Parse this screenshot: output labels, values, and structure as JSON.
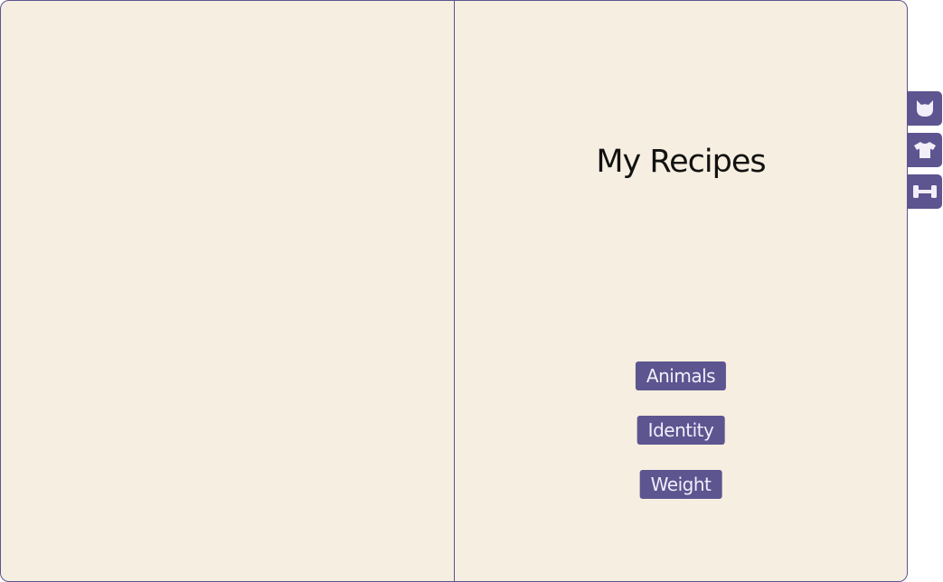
{
  "book": {
    "title": "My Recipes",
    "categories": [
      {
        "label": "Animals"
      },
      {
        "label": "Identity"
      },
      {
        "label": "Weight"
      }
    ]
  },
  "side_tabs": [
    {
      "icon": "cat-head-icon"
    },
    {
      "icon": "tshirt-icon"
    },
    {
      "icon": "dumbbell-icon"
    }
  ],
  "colors": {
    "page_background": "#f6eee0",
    "accent": "#5c5590",
    "button_text": "#f2eefa",
    "title_text": "#111111"
  }
}
